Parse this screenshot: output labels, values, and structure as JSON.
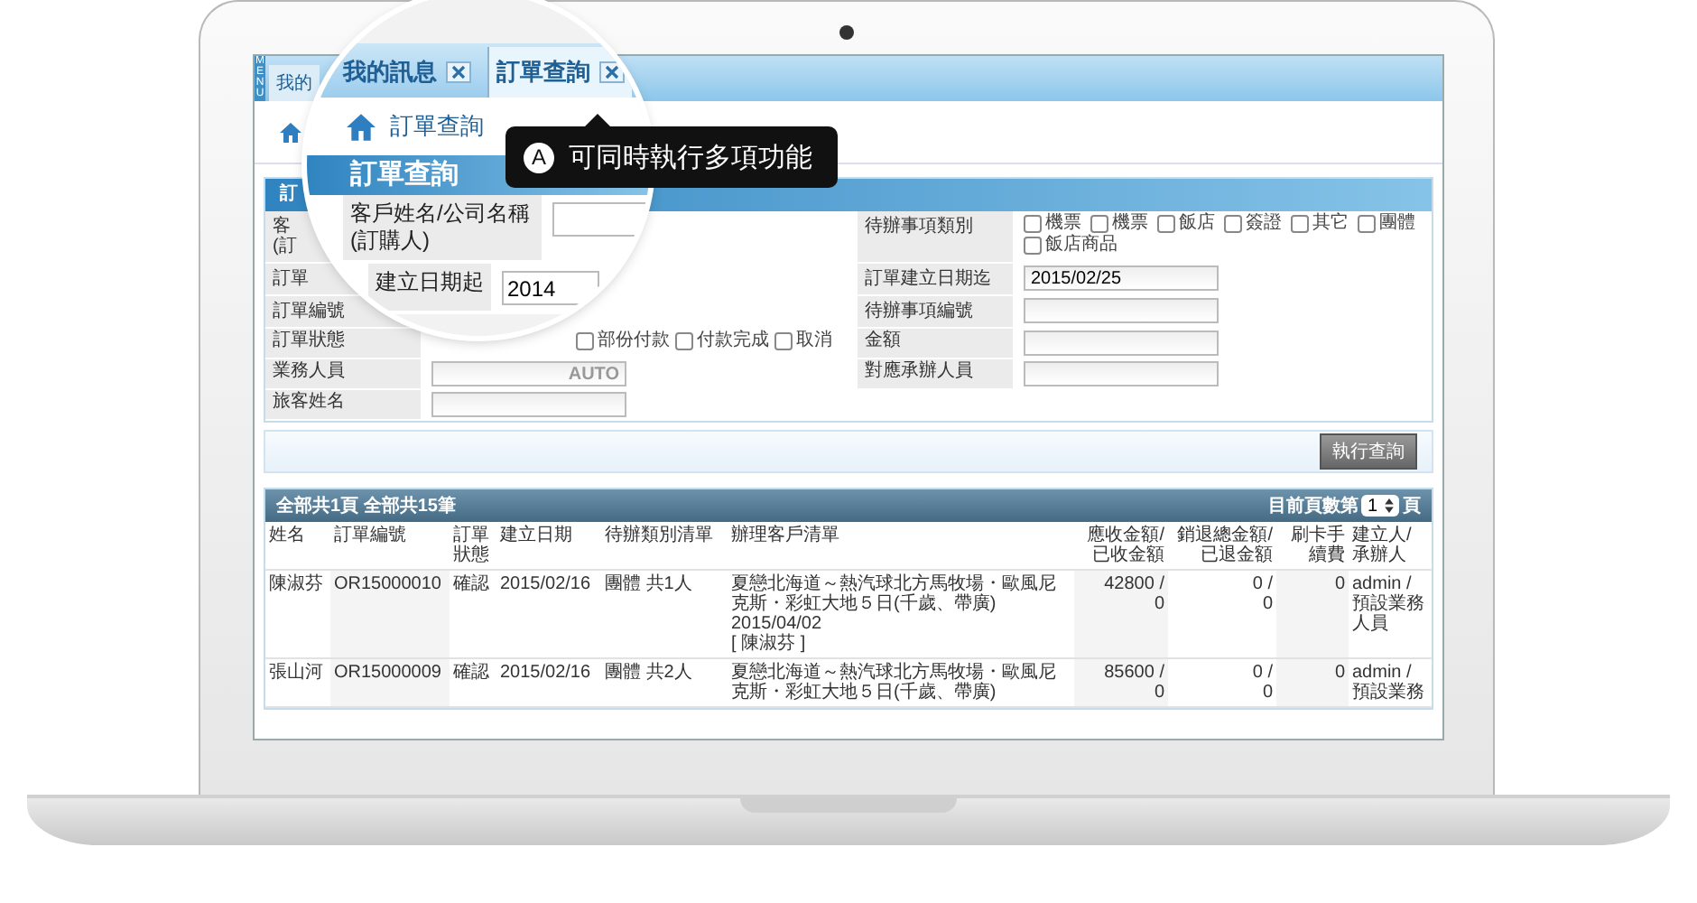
{
  "app": {
    "menu_label": "MENU",
    "tabs": [
      {
        "label": "我的",
        "selected": false
      }
    ],
    "form": {
      "title": "訂",
      "rows": [
        {
          "left": {
            "label": "客\n(訂",
            "kind": "none"
          },
          "right": {
            "label": "待辦事項類別",
            "kind": "checks",
            "options": [
              {
                "label": "機票",
                "checked": false
              },
              {
                "label": "機票",
                "checked": false
              },
              {
                "label": "飯店",
                "checked": false
              },
              {
                "label": "簽證",
                "checked": false
              },
              {
                "label": "其它",
                "checked": false
              },
              {
                "label": "團體",
                "checked": false
              },
              {
                "label": "飯店商品",
                "checked": false
              }
            ]
          }
        },
        {
          "left": {
            "label": "訂單",
            "kind": "none"
          },
          "right": {
            "label": "訂單建立日期迄",
            "kind": "text",
            "value": "2015/02/25"
          }
        },
        {
          "left": {
            "label": "訂單編號",
            "kind": "none"
          },
          "right": {
            "label": "待辦事項編號",
            "kind": "text"
          }
        },
        {
          "left": {
            "label": "訂單狀態",
            "kind": "checks",
            "options": [
              {
                "label": "部份付款",
                "checked": false
              },
              {
                "label": "付款完成",
                "checked": false
              },
              {
                "label": "取消",
                "checked": false
              }
            ]
          },
          "right": {
            "label": "金額",
            "kind": "text"
          }
        },
        {
          "left": {
            "label": "業務人員",
            "kind": "text",
            "placeholder": "AUTO"
          },
          "right": {
            "label": "對應承辦人員",
            "kind": "text"
          }
        },
        {
          "left": {
            "label": "旅客姓名",
            "kind": "text"
          },
          "right": null
        }
      ],
      "submit": "執行查詢"
    },
    "results": {
      "summary": "全部共1頁 全部共15筆",
      "pager_prefix": "目前頁數第",
      "page": "1",
      "pager_suffix": "頁",
      "columns": [
        "姓名",
        "訂單編號",
        "訂單狀態",
        "建立日期",
        "待辦類別清單",
        "辦理客戶清單",
        "應收金額/已收金額",
        "銷退總金額/已退金額",
        "刷卡手續費",
        "建立人/承辦人"
      ],
      "rows": [
        [
          "陳淑芬",
          "OR15000010",
          "確認",
          "2015/02/16",
          "團體 共1人",
          "夏戀北海道～熱汽球北方馬牧場・歐風尼克斯・彩虹大地５日(千歲、帶廣)\n2015/04/02\n[ 陳淑芬 ]",
          "42800 /\n0",
          "0 /\n0",
          "0",
          "admin / 預設業務人員"
        ],
        [
          "張山河",
          "OR15000009",
          "確認",
          "2015/02/16",
          "團體 共2人",
          "夏戀北海道～熱汽球北方馬牧場・歐風尼克斯・彩虹大地５日(千歲、帶廣)",
          "85600 /\n0",
          "0 /\n0",
          "0",
          "admin / 預設業務"
        ]
      ]
    }
  },
  "magnifier": {
    "tabs": [
      {
        "label": "我的訊息",
        "selected": false
      },
      {
        "label": "訂單查詢",
        "selected": true
      }
    ],
    "breadcrumb": "訂單查詢",
    "panel_title": "訂單查詢",
    "rows": [
      {
        "label": "客戶姓名/公司名稱(訂購人)"
      },
      {
        "label": "建立日期起",
        "value": "2014"
      }
    ]
  },
  "tooltip": {
    "badge": "A",
    "text": "可同時執行多項功能"
  }
}
